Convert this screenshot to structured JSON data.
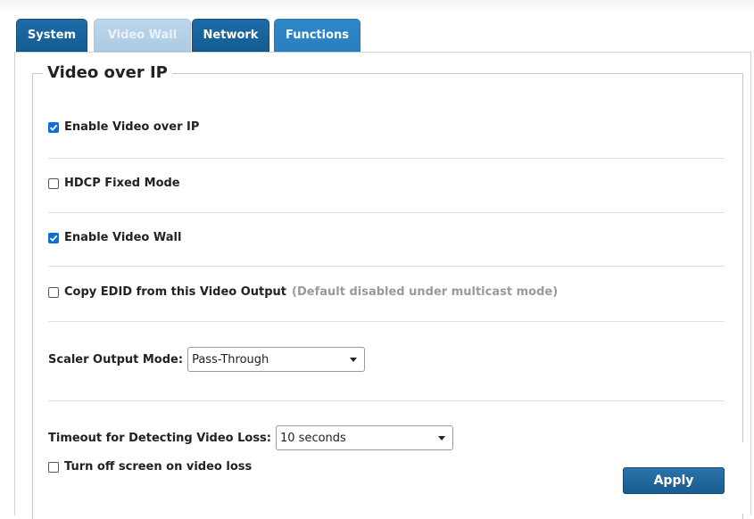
{
  "tabs": [
    {
      "label": "System"
    },
    {
      "label": "Video Wall"
    },
    {
      "label": "Network"
    },
    {
      "label": "Functions"
    }
  ],
  "section": {
    "title": "Video over IP"
  },
  "options": {
    "enable_video_over_ip": {
      "label": "Enable Video over IP",
      "checked": true
    },
    "hdcp_fixed_mode": {
      "label": "HDCP Fixed Mode",
      "checked": false
    },
    "enable_video_wall": {
      "label": "Enable Video Wall",
      "checked": true
    },
    "copy_edid": {
      "label": "Copy EDID from this Video Output",
      "note": "(Default disabled under multicast mode)",
      "checked": false
    },
    "turn_off_screen": {
      "label": "Turn off screen on video loss",
      "checked": false
    }
  },
  "scaler": {
    "label": "Scaler Output Mode:",
    "value": "Pass-Through"
  },
  "timeout": {
    "label": "Timeout for Detecting Video Loss:",
    "value": "10 seconds"
  },
  "apply_label": "Apply",
  "colors": {
    "tab_dark": "#165f95",
    "tab_active": "#b3cfe6",
    "tab_functions": "#2d83c4",
    "checkbox_checked": "#0b6fd8",
    "apply_button": "#1f6498"
  },
  "icons": {
    "checkmark": "check-icon",
    "dropdown": "chevron-down-icon"
  }
}
